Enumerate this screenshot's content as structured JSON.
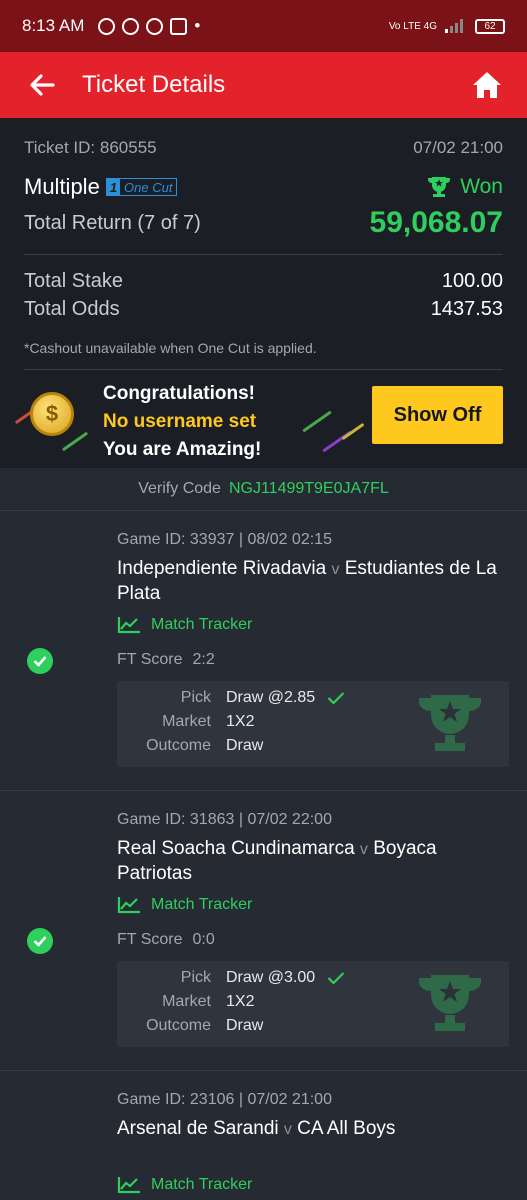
{
  "status_bar": {
    "time": "8:13 AM",
    "network": "Vo LTE 4G",
    "battery": "62"
  },
  "app_bar": {
    "title": "Ticket Details"
  },
  "ticket": {
    "id_label": "Ticket ID: 860555",
    "datetime": "07/02 21:00",
    "type": "Multiple",
    "one_cut_num": "1",
    "one_cut_label": "One Cut",
    "status": "Won",
    "return_label": "Total Return (7 of 7)",
    "return_value": "59,068.07",
    "stake_label": "Total Stake",
    "stake_value": "100.00",
    "odds_label": "Total Odds",
    "odds_value": "1437.53",
    "note": "*Cashout unavailable when One Cut is applied."
  },
  "banner": {
    "line1": "Congratulations!",
    "line2": "No username set",
    "line3": "You are Amazing!",
    "button": "Show Off",
    "coin_symbol": "$"
  },
  "verify": {
    "label": "Verify Code",
    "code": "NGJ11499T9E0JA7FL"
  },
  "labels": {
    "match_tracker": "Match Tracker",
    "ft_score": "FT Score",
    "pick": "Pick",
    "market": "Market",
    "outcome": "Outcome",
    "versus": "v"
  },
  "games": [
    {
      "meta": "Game ID: 33937 | 08/02 02:15",
      "home": "Independiente Rivadavia",
      "away": "Estudiantes de La Plata",
      "score": "2:2",
      "pick": "Draw @2.85",
      "market": "1X2",
      "outcome": "Draw"
    },
    {
      "meta": "Game ID: 31863 | 07/02 22:00",
      "home": "Real Soacha Cundinamarca",
      "away": "Boyaca Patriotas",
      "score": "0:0",
      "pick": "Draw @3.00",
      "market": "1X2",
      "outcome": "Draw"
    },
    {
      "meta": "Game ID: 23106 | 07/02 21:00",
      "home": "Arsenal de Sarandi",
      "away": "CA All Boys"
    }
  ],
  "colors": {
    "header_red": "#e4222b",
    "status_red": "#7a1218",
    "win_green": "#2fcf5e",
    "accent_yellow": "#ffc81e",
    "one_cut_blue": "#2d8fd6"
  }
}
